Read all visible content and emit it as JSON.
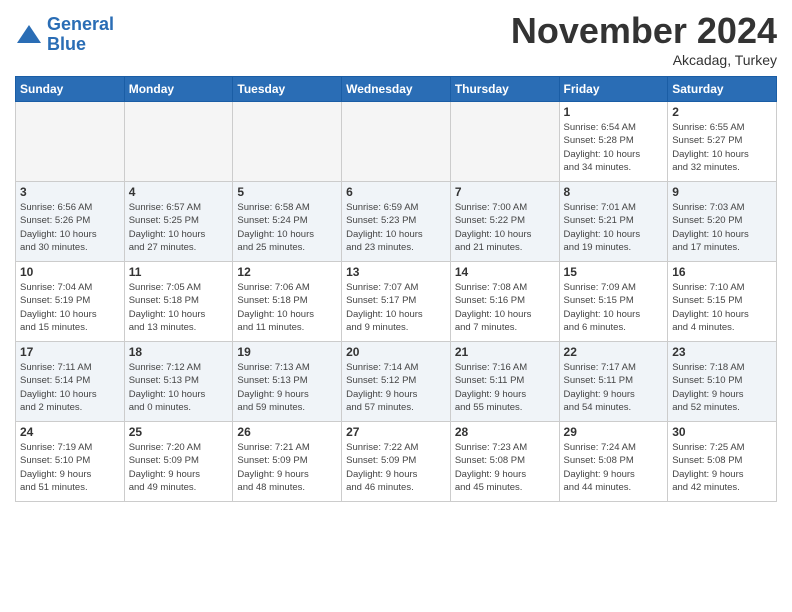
{
  "header": {
    "logo_line1": "General",
    "logo_line2": "Blue",
    "month": "November 2024",
    "location": "Akcadag, Turkey"
  },
  "weekdays": [
    "Sunday",
    "Monday",
    "Tuesday",
    "Wednesday",
    "Thursday",
    "Friday",
    "Saturday"
  ],
  "weeks": [
    [
      {
        "day": "",
        "info": ""
      },
      {
        "day": "",
        "info": ""
      },
      {
        "day": "",
        "info": ""
      },
      {
        "day": "",
        "info": ""
      },
      {
        "day": "",
        "info": ""
      },
      {
        "day": "1",
        "info": "Sunrise: 6:54 AM\nSunset: 5:28 PM\nDaylight: 10 hours\nand 34 minutes."
      },
      {
        "day": "2",
        "info": "Sunrise: 6:55 AM\nSunset: 5:27 PM\nDaylight: 10 hours\nand 32 minutes."
      }
    ],
    [
      {
        "day": "3",
        "info": "Sunrise: 6:56 AM\nSunset: 5:26 PM\nDaylight: 10 hours\nand 30 minutes."
      },
      {
        "day": "4",
        "info": "Sunrise: 6:57 AM\nSunset: 5:25 PM\nDaylight: 10 hours\nand 27 minutes."
      },
      {
        "day": "5",
        "info": "Sunrise: 6:58 AM\nSunset: 5:24 PM\nDaylight: 10 hours\nand 25 minutes."
      },
      {
        "day": "6",
        "info": "Sunrise: 6:59 AM\nSunset: 5:23 PM\nDaylight: 10 hours\nand 23 minutes."
      },
      {
        "day": "7",
        "info": "Sunrise: 7:00 AM\nSunset: 5:22 PM\nDaylight: 10 hours\nand 21 minutes."
      },
      {
        "day": "8",
        "info": "Sunrise: 7:01 AM\nSunset: 5:21 PM\nDaylight: 10 hours\nand 19 minutes."
      },
      {
        "day": "9",
        "info": "Sunrise: 7:03 AM\nSunset: 5:20 PM\nDaylight: 10 hours\nand 17 minutes."
      }
    ],
    [
      {
        "day": "10",
        "info": "Sunrise: 7:04 AM\nSunset: 5:19 PM\nDaylight: 10 hours\nand 15 minutes."
      },
      {
        "day": "11",
        "info": "Sunrise: 7:05 AM\nSunset: 5:18 PM\nDaylight: 10 hours\nand 13 minutes."
      },
      {
        "day": "12",
        "info": "Sunrise: 7:06 AM\nSunset: 5:18 PM\nDaylight: 10 hours\nand 11 minutes."
      },
      {
        "day": "13",
        "info": "Sunrise: 7:07 AM\nSunset: 5:17 PM\nDaylight: 10 hours\nand 9 minutes."
      },
      {
        "day": "14",
        "info": "Sunrise: 7:08 AM\nSunset: 5:16 PM\nDaylight: 10 hours\nand 7 minutes."
      },
      {
        "day": "15",
        "info": "Sunrise: 7:09 AM\nSunset: 5:15 PM\nDaylight: 10 hours\nand 6 minutes."
      },
      {
        "day": "16",
        "info": "Sunrise: 7:10 AM\nSunset: 5:15 PM\nDaylight: 10 hours\nand 4 minutes."
      }
    ],
    [
      {
        "day": "17",
        "info": "Sunrise: 7:11 AM\nSunset: 5:14 PM\nDaylight: 10 hours\nand 2 minutes."
      },
      {
        "day": "18",
        "info": "Sunrise: 7:12 AM\nSunset: 5:13 PM\nDaylight: 10 hours\nand 0 minutes."
      },
      {
        "day": "19",
        "info": "Sunrise: 7:13 AM\nSunset: 5:13 PM\nDaylight: 9 hours\nand 59 minutes."
      },
      {
        "day": "20",
        "info": "Sunrise: 7:14 AM\nSunset: 5:12 PM\nDaylight: 9 hours\nand 57 minutes."
      },
      {
        "day": "21",
        "info": "Sunrise: 7:16 AM\nSunset: 5:11 PM\nDaylight: 9 hours\nand 55 minutes."
      },
      {
        "day": "22",
        "info": "Sunrise: 7:17 AM\nSunset: 5:11 PM\nDaylight: 9 hours\nand 54 minutes."
      },
      {
        "day": "23",
        "info": "Sunrise: 7:18 AM\nSunset: 5:10 PM\nDaylight: 9 hours\nand 52 minutes."
      }
    ],
    [
      {
        "day": "24",
        "info": "Sunrise: 7:19 AM\nSunset: 5:10 PM\nDaylight: 9 hours\nand 51 minutes."
      },
      {
        "day": "25",
        "info": "Sunrise: 7:20 AM\nSunset: 5:09 PM\nDaylight: 9 hours\nand 49 minutes."
      },
      {
        "day": "26",
        "info": "Sunrise: 7:21 AM\nSunset: 5:09 PM\nDaylight: 9 hours\nand 48 minutes."
      },
      {
        "day": "27",
        "info": "Sunrise: 7:22 AM\nSunset: 5:09 PM\nDaylight: 9 hours\nand 46 minutes."
      },
      {
        "day": "28",
        "info": "Sunrise: 7:23 AM\nSunset: 5:08 PM\nDaylight: 9 hours\nand 45 minutes."
      },
      {
        "day": "29",
        "info": "Sunrise: 7:24 AM\nSunset: 5:08 PM\nDaylight: 9 hours\nand 44 minutes."
      },
      {
        "day": "30",
        "info": "Sunrise: 7:25 AM\nSunset: 5:08 PM\nDaylight: 9 hours\nand 42 minutes."
      }
    ]
  ]
}
